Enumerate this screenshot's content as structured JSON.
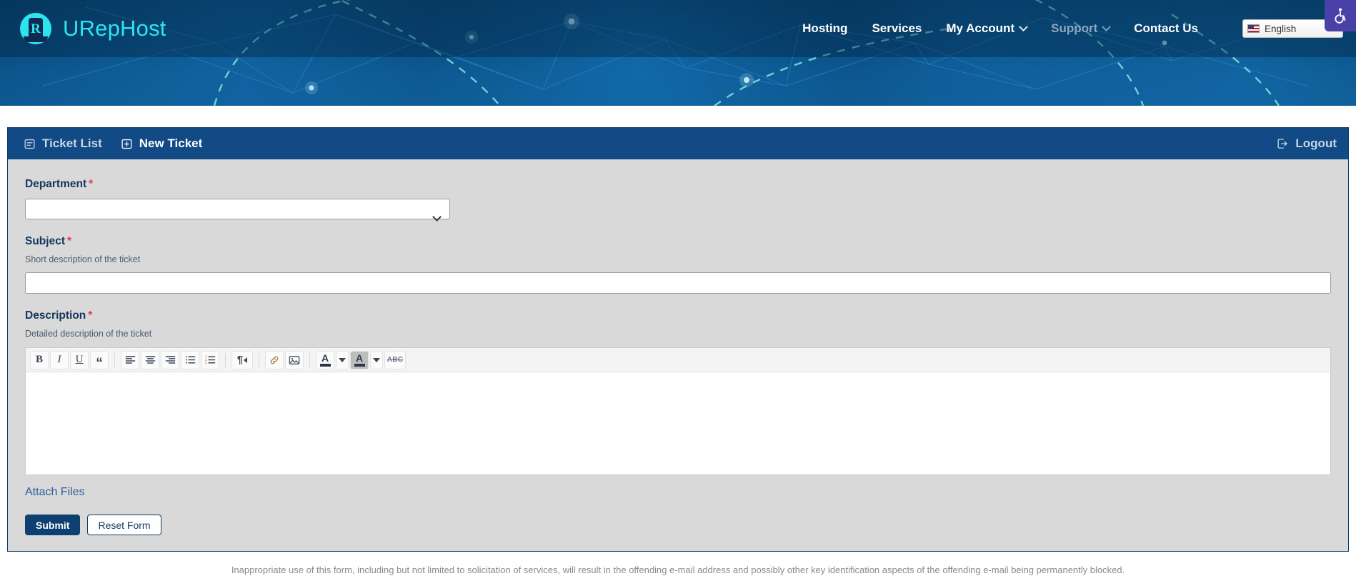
{
  "brand": {
    "name": "URepHost",
    "logo_icon": "urephost-circle-r-logo",
    "accent_color": "#2ce4f0"
  },
  "nav": {
    "items": [
      {
        "label": "Hosting",
        "has_dropdown": false,
        "muted": false
      },
      {
        "label": "Services",
        "has_dropdown": false,
        "muted": false
      },
      {
        "label": "My Account",
        "has_dropdown": true,
        "muted": false
      },
      {
        "label": "Support",
        "has_dropdown": true,
        "muted": true
      },
      {
        "label": "Contact Us",
        "has_dropdown": false,
        "muted": false
      }
    ],
    "language": {
      "label": "English",
      "flag_icon": "us-flag-icon",
      "caret_icon": "chevron-down-icon"
    },
    "accessibility": {
      "icon": "accessibility-wheelchair-icon",
      "color": "#4a41a8"
    }
  },
  "panel": {
    "header": {
      "ticket_list": {
        "label": "Ticket List",
        "icon": "list-box-icon",
        "active": false
      },
      "new_ticket": {
        "label": "New Ticket",
        "icon": "plus-box-icon",
        "active": true
      },
      "logout": {
        "label": "Logout",
        "icon": "sign-out-icon"
      }
    },
    "header_bg": "#124a85",
    "body_bg": "#d9d9d9"
  },
  "form": {
    "department": {
      "label": "Department",
      "required_marker": "*",
      "value": "",
      "placeholder": "",
      "options": [
        ""
      ]
    },
    "subject": {
      "label": "Subject",
      "required_marker": "*",
      "help": "Short description of the ticket",
      "value": "",
      "placeholder": ""
    },
    "description": {
      "label": "Description",
      "required_marker": "*",
      "help": "Detailed description of the ticket",
      "value": ""
    },
    "attach_files": {
      "label": "Attach Files"
    },
    "submit": {
      "label": "Submit"
    },
    "reset": {
      "label": "Reset Form"
    }
  },
  "editor_toolbar": {
    "buttons": [
      {
        "name": "bold-icon",
        "glyph": "B",
        "title": "Bold"
      },
      {
        "name": "italic-icon",
        "glyph": "I",
        "title": "Italic"
      },
      {
        "name": "underline-icon",
        "glyph": "U",
        "title": "Underline"
      },
      {
        "name": "blockquote-icon",
        "glyph": "“",
        "title": "Blockquote"
      },
      {
        "name": "align-left-icon",
        "glyph": "",
        "title": "Align left"
      },
      {
        "name": "align-center-icon",
        "glyph": "",
        "title": "Align center"
      },
      {
        "name": "align-right-icon",
        "glyph": "",
        "title": "Align right"
      },
      {
        "name": "bullet-list-icon",
        "glyph": "",
        "title": "Bulleted list"
      },
      {
        "name": "numbered-list-icon",
        "glyph": "",
        "title": "Numbered list"
      },
      {
        "name": "text-direction-rtl-icon",
        "glyph": "¶",
        "title": "Text direction"
      },
      {
        "name": "link-icon",
        "glyph": "",
        "title": "Insert link"
      },
      {
        "name": "image-icon",
        "glyph": "",
        "title": "Insert image"
      },
      {
        "name": "font-color-icon",
        "glyph": "A",
        "title": "Font color"
      },
      {
        "name": "font-color-dropdown-icon",
        "glyph": "",
        "title": "Font color options"
      },
      {
        "name": "highlight-color-icon",
        "glyph": "A",
        "title": "Highlight color"
      },
      {
        "name": "highlight-color-dropdown-icon",
        "glyph": "",
        "title": "Highlight color options"
      },
      {
        "name": "strikethrough-icon",
        "glyph": "ABC",
        "title": "Strikethrough"
      }
    ]
  },
  "footer": {
    "note": "Inappropriate use of this form, including but not limited to solicitation of services, will result in the offending e-mail address and possibly other key identification aspects of the offending e-mail being permanently blocked."
  }
}
